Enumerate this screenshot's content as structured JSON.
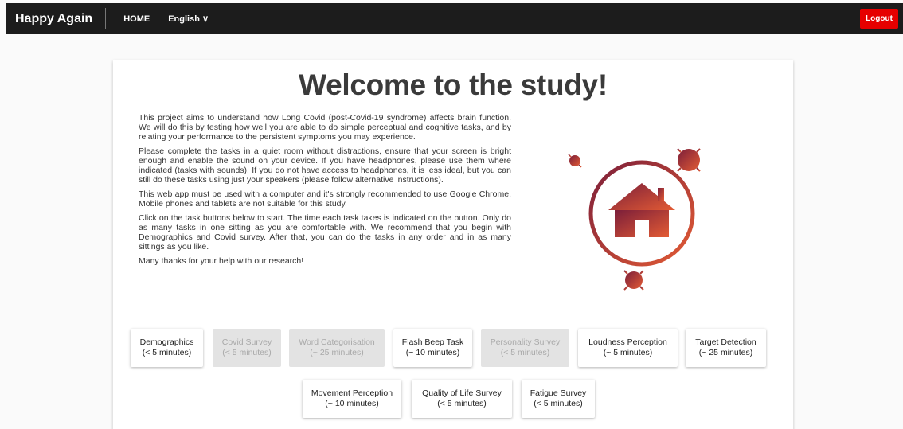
{
  "nav": {
    "brand": "Happy Again",
    "home": "HOME",
    "language": "English ∨",
    "logout": "Logout"
  },
  "page": {
    "title": "Welcome to the study!",
    "paragraphs": [
      "This project aims to understand how Long Covid (post-Covid-19 syndrome) affects brain function. We will do this by testing how well you are able to do simple perceptual and cognitive tasks, and by relating your performance to the persistent symptoms you may experience.",
      "Please complete the tasks in a quiet room without distractions, ensure that your screen is bright enough and enable the sound on your device. If you have headphones, please use them where indicated (tasks with sounds). If you do not have access to headphones, it is less ideal, but you can still do these tasks using just your speakers (please follow alternative instructions).",
      "This web app must be used with a computer and it's strongly recommended to use Google Chrome. Mobile phones and tablets are not suitable for this study.",
      "Click on the task buttons below to start. The time each task takes is indicated on the button. Only do as many tasks in one sitting as you are comfortable with. We recommend that you begin with Demographics and Covid survey. After that, you can do the tasks in any order and in as many sittings as you like.",
      "Many thanks for your help with our research!"
    ]
  },
  "tasks": [
    {
      "name": "Demographics",
      "time": "(< 5 minutes)",
      "enabled": true
    },
    {
      "name": "Covid Survey",
      "time": "(< 5 minutes)",
      "enabled": false
    },
    {
      "name": "Word Categorisation",
      "time": "(~ 25 minutes)",
      "enabled": false
    },
    {
      "name": "Flash Beep Task",
      "time": "(~ 10 minutes)",
      "enabled": true
    },
    {
      "name": "Personality Survey",
      "time": "(< 5 minutes)",
      "enabled": false
    },
    {
      "name": "Loudness Perception",
      "time": "(~ 5 minutes)",
      "enabled": true
    },
    {
      "name": "Target Detection",
      "time": "(~ 25 minutes)",
      "enabled": true
    },
    {
      "name": "Movement Perception",
      "time": "(~ 10 minutes)",
      "enabled": true
    },
    {
      "name": "Quality of Life Survey",
      "time": "(< 5 minutes)",
      "enabled": true
    },
    {
      "name": "Fatigue Survey",
      "time": "(< 5 minutes)",
      "enabled": true
    }
  ],
  "colors": {
    "accent": "#e60000",
    "icon_dark": "#7b1e3a",
    "icon_light": "#e35b34"
  }
}
